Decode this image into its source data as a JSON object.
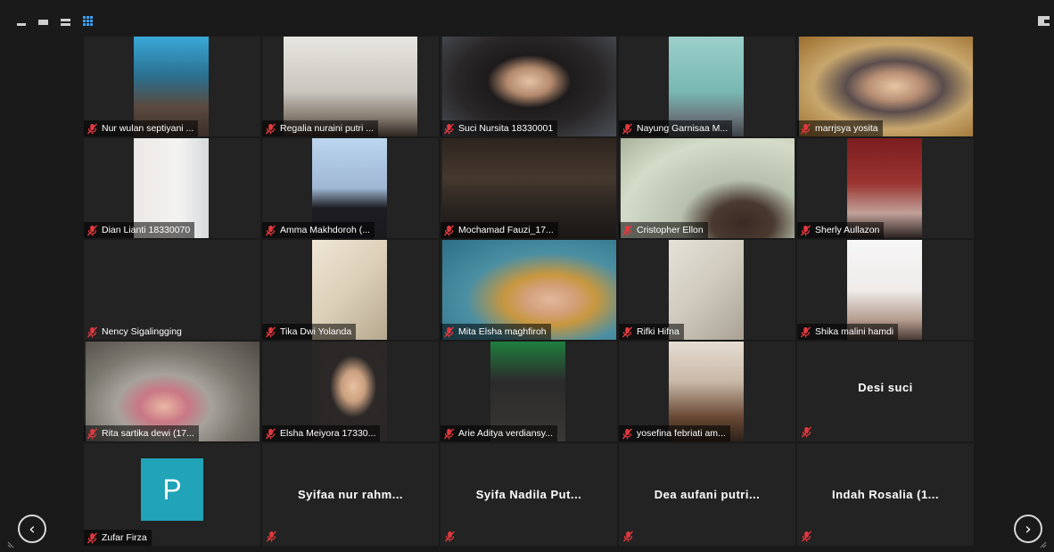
{
  "window": {
    "view_controls": [
      "minimize-view",
      "single-speaker-view",
      "two-row-view",
      "gallery-view"
    ]
  },
  "colors": {
    "accent_grid_icon": "#3aa0f0",
    "avatar_bg": "#21a3b8",
    "mute_icon": "#e0393e",
    "tile_bg": "#232323"
  },
  "participants": [
    {
      "name": "Nur wulan septiyani ...",
      "video": true
    },
    {
      "name": "Regalia nuraini putri ...",
      "video": true
    },
    {
      "name": "Suci Nursita 18330001",
      "video": true
    },
    {
      "name": "Nayung Garnisaa M...",
      "video": true
    },
    {
      "name": "marrjsya yosita",
      "video": true
    },
    {
      "name": "Dian Lianti 18330070",
      "video": true
    },
    {
      "name": "Amma Makhdoroh (...",
      "video": true
    },
    {
      "name": "Mochamad Fauzi_17...",
      "video": true
    },
    {
      "name": "Cristopher Ellon",
      "video": true
    },
    {
      "name": "Sherly Aullazon",
      "video": true
    },
    {
      "name": "Nency Sigalingging",
      "video": false
    },
    {
      "name": "Tika Dwi Yolanda",
      "video": true
    },
    {
      "name": "Mita Elsha maghfiroh",
      "video": true
    },
    {
      "name": "Rifki Hifna",
      "video": true
    },
    {
      "name": "Shika malini hamdi",
      "video": true
    },
    {
      "name": "Rita sartika dewi (17...",
      "video": true
    },
    {
      "name": "Elsha Meiyora 17330...",
      "video": true
    },
    {
      "name": "Arie Aditya verdiansy...",
      "video": true
    },
    {
      "name": "yosefina febriati am...",
      "video": true
    },
    {
      "name": "Desi suci",
      "video": false,
      "big_name": true
    },
    {
      "name": "Zufar Firza",
      "video": false,
      "avatar_letter": "P"
    },
    {
      "name": "Syifaa nur rahm...",
      "video": false,
      "big_name": true
    },
    {
      "name": "Syifa Nadila Put...",
      "video": false,
      "big_name": true
    },
    {
      "name": "Dea aufani putri...",
      "video": false,
      "big_name": true
    },
    {
      "name": "Indah Rosalia (1...",
      "video": false,
      "big_name": true
    }
  ],
  "navigation": {
    "prev_icon": "chevron-left-icon",
    "next_icon": "chevron-right-icon"
  }
}
